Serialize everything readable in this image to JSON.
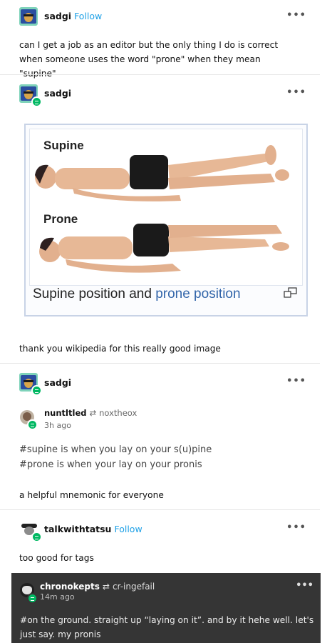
{
  "posts": {
    "first": {
      "username": "sadgi",
      "follow_label": "Follow",
      "body": "can I get a job as an editor but the only thing I do is correct when someone uses the word \"prone\" when they mean \"supine\""
    },
    "second": {
      "username": "sadgi",
      "image": {
        "label_top": "Supine",
        "label_bottom": "Prone",
        "caption_part1": "Supine position and ",
        "caption_part2": "prone position"
      },
      "body": "thank you wikipedia for this really good image"
    },
    "third": {
      "username": "sadgi",
      "reblog": {
        "username": "nuntltled",
        "via": "noxtheox",
        "time": "3h ago"
      },
      "tags_line1": "#supine is when you lay on your s(u)pine",
      "tags_line2": "#prone is when your lay on your pronis",
      "body": "a helpful mnemonic for everyone"
    },
    "fourth": {
      "username": "talkwithtatsu",
      "follow_label": "Follow",
      "body": "too good for tags"
    },
    "fifth": {
      "username": "chronokepts",
      "via": "cr-ingefail",
      "time": "14m ago",
      "body": "#on the ground. straight up “laying on it”. and by it hehe well. let's just say. my pronis"
    }
  },
  "icons": {
    "more": "more-dots-icon",
    "reblog": "reblog-icon",
    "enlarge": "enlarge-icon"
  },
  "colors": {
    "follow": "#1ea0e6",
    "badge": "#00b862",
    "caption_link": "#3366aa",
    "dark_panel": "#353535"
  }
}
